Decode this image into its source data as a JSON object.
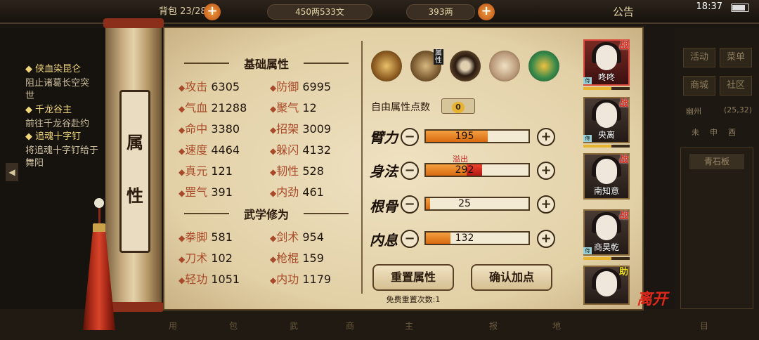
{
  "topbar": {
    "bag": "23/280",
    "copper": "450两533文",
    "silver": "393两",
    "notice": "公告",
    "time": "18:37"
  },
  "quests": [
    {
      "title": "侠血染昆仑",
      "desc": [
        "阻止诸葛长空突",
        "世"
      ]
    },
    {
      "title": "千龙谷主",
      "desc": [
        "前往千龙谷赴约"
      ]
    },
    {
      "title": "追魂十字钉",
      "desc": [
        "将追魂十字钉给于",
        "舞阳"
      ]
    }
  ],
  "right_panel": {
    "buttons": [
      "活动",
      "菜单",
      "商城",
      "社区"
    ],
    "location": "幽州",
    "coords": "(25,32)",
    "time_tabs": [
      "未",
      "申",
      "酉"
    ],
    "board": "青石板"
  },
  "scroll": {
    "name_chars": [
      "属",
      "性"
    ]
  },
  "basic": {
    "title": "基础属性",
    "stats": [
      {
        "label": "攻击",
        "value": "6305"
      },
      {
        "label": "防御",
        "value": "6995"
      },
      {
        "label": "气血",
        "value": "21288"
      },
      {
        "label": "聚气",
        "value": "12"
      },
      {
        "label": "命中",
        "value": "3380"
      },
      {
        "label": "招架",
        "value": "3009"
      },
      {
        "label": "速度",
        "value": "4464"
      },
      {
        "label": "躲闪",
        "value": "4132"
      },
      {
        "label": "真元",
        "value": "121"
      },
      {
        "label": "韧性",
        "value": "528"
      },
      {
        "label": "罡气",
        "value": "391"
      },
      {
        "label": "内劲",
        "value": "461"
      }
    ]
  },
  "martial": {
    "title": "武学修为",
    "stats": [
      {
        "label": "拳脚",
        "value": "581"
      },
      {
        "label": "剑术",
        "value": "954"
      },
      {
        "label": "刀术",
        "value": "102"
      },
      {
        "label": "枪棍",
        "value": "159"
      },
      {
        "label": "轻功",
        "value": "1051"
      },
      {
        "label": "内功",
        "value": "1179"
      }
    ]
  },
  "equip_tag": "属性",
  "free_points": {
    "label": "自由属性点数",
    "value": "0"
  },
  "attributes": [
    {
      "name": "臂力",
      "value": "195",
      "fill": 0.6,
      "over": 0
    },
    {
      "name": "身法",
      "value": "292",
      "fill": 0.4,
      "over": 0.15
    },
    {
      "name": "根骨",
      "value": "25",
      "fill": 0.04,
      "over": 0
    },
    {
      "name": "内息",
      "value": "132",
      "fill": 0.24,
      "over": 0
    }
  ],
  "overflow_label": "溢出",
  "buttons": {
    "reset": "重置属性",
    "confirm": "确认加点"
  },
  "reset_count": "免费重置次数:1",
  "party": [
    {
      "name": "咚咚",
      "badge": "战",
      "tag": "侍"
    },
    {
      "name": "央离",
      "badge": "战",
      "tag": "侍"
    },
    {
      "name": "南知意",
      "badge": "战",
      "tag": ""
    },
    {
      "name": "商昊乾",
      "badge": "战",
      "tag": "侍"
    },
    {
      "name": "",
      "badge": "助",
      "tag": ""
    }
  ],
  "leave": "离开",
  "bottom_nav": [
    "用",
    "包",
    "武",
    "商",
    "主",
    "报",
    "地",
    "目"
  ]
}
